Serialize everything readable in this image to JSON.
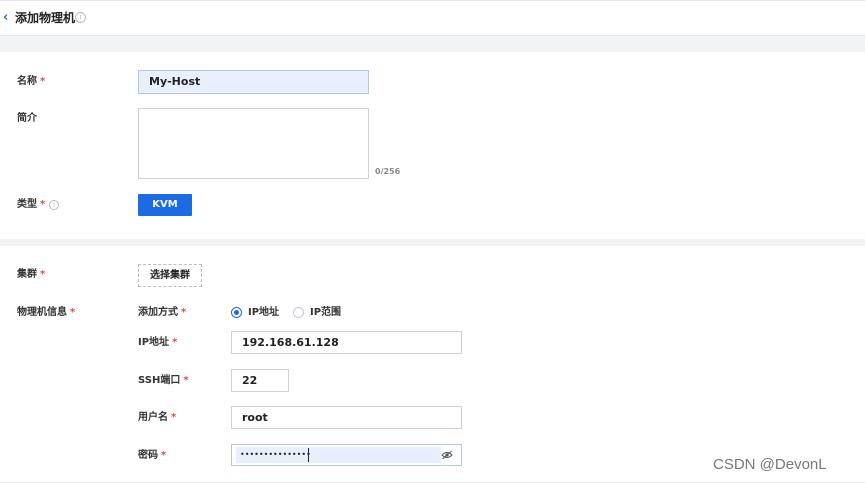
{
  "header": {
    "title": "添加物理机"
  },
  "form": {
    "name": {
      "label": "名称",
      "value": "My-Host"
    },
    "description": {
      "label": "简介",
      "value": "",
      "counter": "0/256"
    },
    "type": {
      "label": "类型",
      "selected": "KVM"
    },
    "cluster": {
      "label": "集群",
      "button_label": "选择集群"
    },
    "host_info": {
      "label": "物理机信息",
      "add_method": {
        "label": "添加方式",
        "options": [
          {
            "label": "IP地址",
            "checked": true
          },
          {
            "label": "IP范围",
            "checked": false
          }
        ]
      },
      "ip": {
        "label": "IP地址",
        "value": "192.168.61.128"
      },
      "ssh_port": {
        "label": "SSH端口",
        "value": "22"
      },
      "username": {
        "label": "用户名",
        "value": "root"
      },
      "password": {
        "label": "密码",
        "masked_value": "•••••••••••••••"
      }
    },
    "required_mark": "*"
  },
  "watermark": "CSDN @DevonL",
  "colors": {
    "accent": "#1d6ae5",
    "required": "#e5484d",
    "autofill": "#e8f0fe"
  }
}
